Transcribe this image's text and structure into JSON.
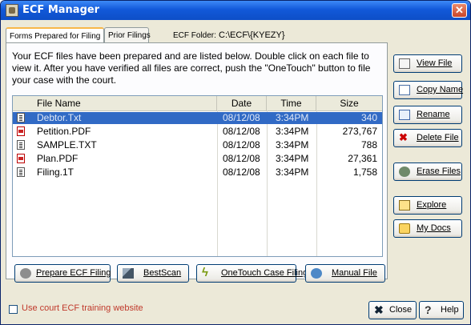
{
  "window": {
    "title": "ECF Manager",
    "close_glyph": "✕"
  },
  "tabs": [
    {
      "label": "Forms Prepared for Filing",
      "active": true
    },
    {
      "label": "Prior Filings",
      "active": false
    }
  ],
  "folder": {
    "label": "ECF Folder:",
    "value": "C:\\ECF\\{KYEZY}"
  },
  "description": "Your ECF files have been prepared and are listed below. Double click on each file to view it. After you have verified all files are correct, push the \"OneTouch\" button to file your case with the court.",
  "table": {
    "headers": [
      "File Name",
      "Date",
      "Time",
      "Size"
    ],
    "rows": [
      {
        "name": "Debtor.Txt",
        "date": "08/12/08",
        "time": "3:34PM",
        "size": "340",
        "icon": "text-file-icon",
        "selected": true
      },
      {
        "name": "Petition.PDF",
        "date": "08/12/08",
        "time": "3:34PM",
        "size": "273,767",
        "icon": "pdf-file-icon",
        "selected": false
      },
      {
        "name": "SAMPLE.TXT",
        "date": "08/12/08",
        "time": "3:34PM",
        "size": "788",
        "icon": "text-file-icon",
        "selected": false
      },
      {
        "name": "Plan.PDF",
        "date": "08/12/08",
        "time": "3:34PM",
        "size": "27,361",
        "icon": "pdf-file-icon",
        "selected": false
      },
      {
        "name": "Filing.1T",
        "date": "08/12/08",
        "time": "3:34PM",
        "size": "1,758",
        "icon": "text-file-icon",
        "selected": false
      }
    ]
  },
  "side_buttons": {
    "view_file": "View File",
    "copy_name": "Copy Name",
    "rename": "Rename",
    "delete_file": "Delete File",
    "erase_files": "Erase Files",
    "explore": "Explore",
    "my_docs": "My Docs"
  },
  "action_buttons": {
    "prepare": "Prepare ECF Filing",
    "bestscan": "BestScan",
    "onetouch": "OneTouch Case Filing",
    "manual": "Manual File"
  },
  "footer": {
    "training_checkbox_label": "Use court ECF training website",
    "training_checked": false,
    "close": "Close",
    "help": "Help"
  },
  "colors": {
    "selection": "#316ac5",
    "titlebar": "#1259d9",
    "warning_text": "#c0392b"
  }
}
